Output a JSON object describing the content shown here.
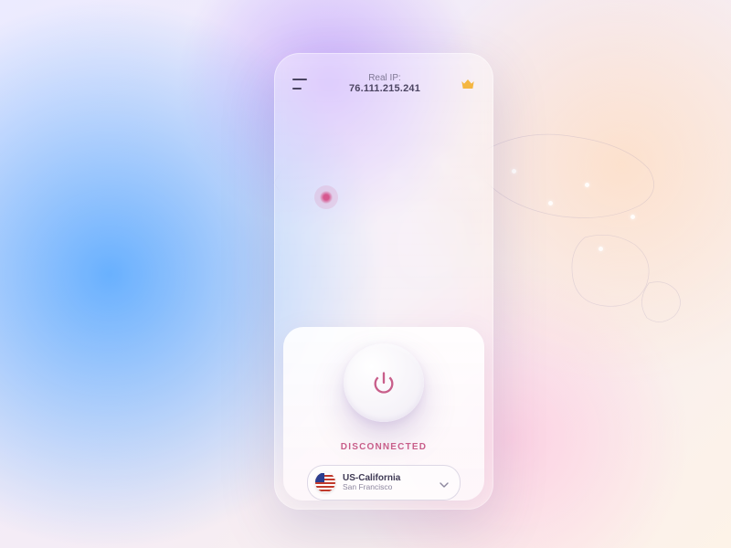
{
  "header": {
    "ip_label": "Real IP:",
    "ip_value": "76.111.215.241"
  },
  "connection": {
    "status": "DISCONNECTED"
  },
  "server": {
    "name": "US-California",
    "city": "San Francisco",
    "flag": "us"
  },
  "colors": {
    "accent": "#c85e8a",
    "crown": "#f4b641"
  }
}
